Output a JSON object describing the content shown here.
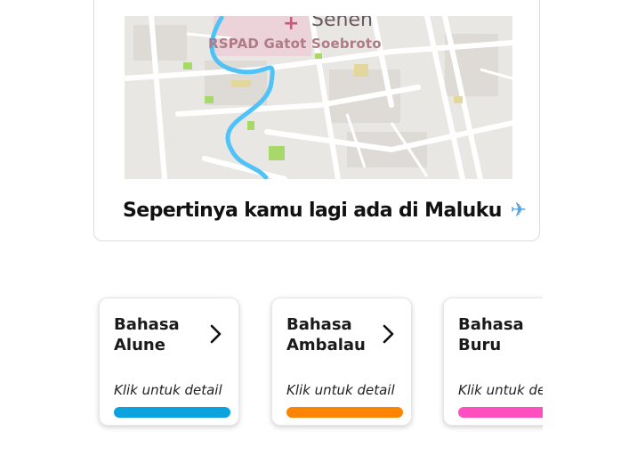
{
  "location": {
    "map": {
      "hospital_label": "RSPAD Gatot Soebroto",
      "district_label": "Senen",
      "hospital_icon": "hospital-cross-icon"
    },
    "message": "Sepertinya kamu lagi ada di Maluku",
    "icon": "airplane-icon"
  },
  "languages": [
    {
      "title": "Bahasa\nAlune",
      "detail": "Klik untuk detail",
      "color": "#0aa3df",
      "icon": "chevron-right-icon"
    },
    {
      "title": "Bahasa\nAmbalau",
      "detail": "Klik untuk detail",
      "color": "#fb8405",
      "icon": "chevron-right-icon"
    },
    {
      "title": "Bahasa\nBuru",
      "detail": "Klik untuk detail",
      "color": "#fd4fbf",
      "icon": "chevron-right-icon"
    }
  ]
}
